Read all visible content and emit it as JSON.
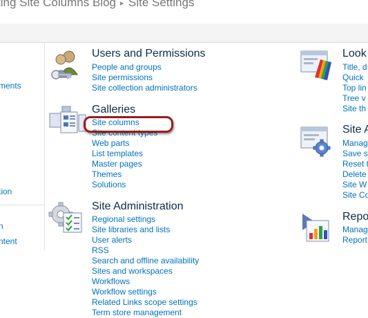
{
  "breadcrumb": {
    "site": "ting Site Columns Blog",
    "separator": "▸",
    "page": "Site Settings"
  },
  "leftnav": [
    "ments",
    "tion",
    "n",
    "ntent"
  ],
  "sections": {
    "users": {
      "title": "Users and Permissions",
      "links": [
        "People and groups",
        "Site permissions",
        "Site collection administrators"
      ]
    },
    "galleries": {
      "title": "Galleries",
      "links": [
        "Site columns",
        "Site content types",
        "Web parts",
        "List templates",
        "Master pages",
        "Themes",
        "Solutions"
      ]
    },
    "site_admin": {
      "title": "Site Administration",
      "links": [
        "Regional settings",
        "Site libraries and lists",
        "User alerts",
        "RSS",
        "Search and offline availability",
        "Sites and workspaces",
        "Workflows",
        "Workflow settings",
        "Related Links scope settings",
        "Term store management"
      ]
    },
    "look": {
      "title": "Look",
      "links": [
        "Title, d",
        "Quick",
        "Top lin",
        "Tree v",
        "Site th"
      ]
    },
    "site_actions": {
      "title": "Site A",
      "links": [
        "Manag",
        "Save s",
        "Reset t",
        "Delete",
        "Site W",
        "Site Co"
      ]
    },
    "reports": {
      "title": "Repo",
      "links": [
        "Manag",
        "Report"
      ]
    }
  },
  "highlight_color": "#9b1b1b",
  "link_color": "#0072bc"
}
